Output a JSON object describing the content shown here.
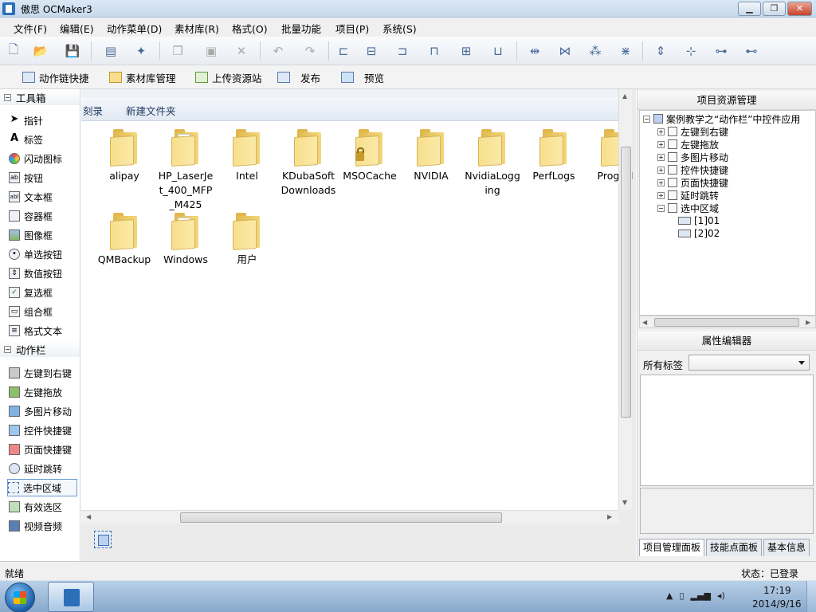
{
  "window": {
    "title": "傲思 OCMaker3",
    "min": "▁",
    "max": "❐",
    "close": "✕"
  },
  "menu": [
    "文件(F)",
    "编辑(E)",
    "动作菜单(D)",
    "素材库(R)",
    "格式(O)",
    "批量功能",
    "项目(P)",
    "系统(S)"
  ],
  "toolbar2": {
    "action_chain": "动作链快捷",
    "library": "素材库管理",
    "upload": "上传资源站",
    "publish": "发布",
    "preview": "预览"
  },
  "toolbox": {
    "title": "工具箱",
    "items": [
      "指针",
      "标签",
      "闪动图标",
      "按钮",
      "文本框",
      "容器框",
      "图像框",
      "单选按钮",
      "数值按钮",
      "复选框",
      "组合框",
      "格式文本"
    ]
  },
  "actionbar": {
    "title": "动作栏",
    "items": [
      "左键到右键",
      "左键拖放",
      "多图片移动",
      "控件快捷键",
      "页面快捷键",
      "延时跳转",
      "选中区域",
      "有效选区",
      "视频音频"
    ]
  },
  "file_browser": {
    "toolbar": {
      "left": "刻录",
      "new_folder": "新建文件夹"
    },
    "folders": [
      {
        "name": "alipay",
        "type": "normal"
      },
      {
        "name": "HP_LaserJet_400_MFP_M425",
        "type": "paper"
      },
      {
        "name": "Intel",
        "type": "normal"
      },
      {
        "name": "KDubaSoftDownloads",
        "type": "normal"
      },
      {
        "name": "MSOCache",
        "type": "locked"
      },
      {
        "name": "NVIDIA",
        "type": "normal"
      },
      {
        "name": "NvidiaLogging",
        "type": "normal"
      },
      {
        "name": "PerfLogs",
        "type": "normal"
      },
      {
        "name": "Prog Fil",
        "type": "normal"
      },
      {
        "name": "QMBackup",
        "type": "normal"
      },
      {
        "name": "Windows",
        "type": "paper"
      },
      {
        "name": "用户",
        "type": "normal"
      }
    ]
  },
  "project_panel": {
    "title": "项目资源管理",
    "root": "案例教学之“动作栏”中控件应用",
    "nodes": [
      "左键到右键",
      "左键拖放",
      "多图片移动",
      "控件快捷键",
      "页面快捷键",
      "延时跳转",
      "选中区域"
    ],
    "children": [
      "[1]01",
      "[2]02"
    ]
  },
  "property_panel": {
    "title": "属性编辑器",
    "tags_label": "所有标签",
    "tags_value": ""
  },
  "panel_tabs": [
    "项目管理面板",
    "技能点面板",
    "基本信息"
  ],
  "status": {
    "left": "就绪",
    "right": "状态：已登录"
  },
  "taskbar": {
    "time": "17:19",
    "date": "2014/9/16"
  }
}
